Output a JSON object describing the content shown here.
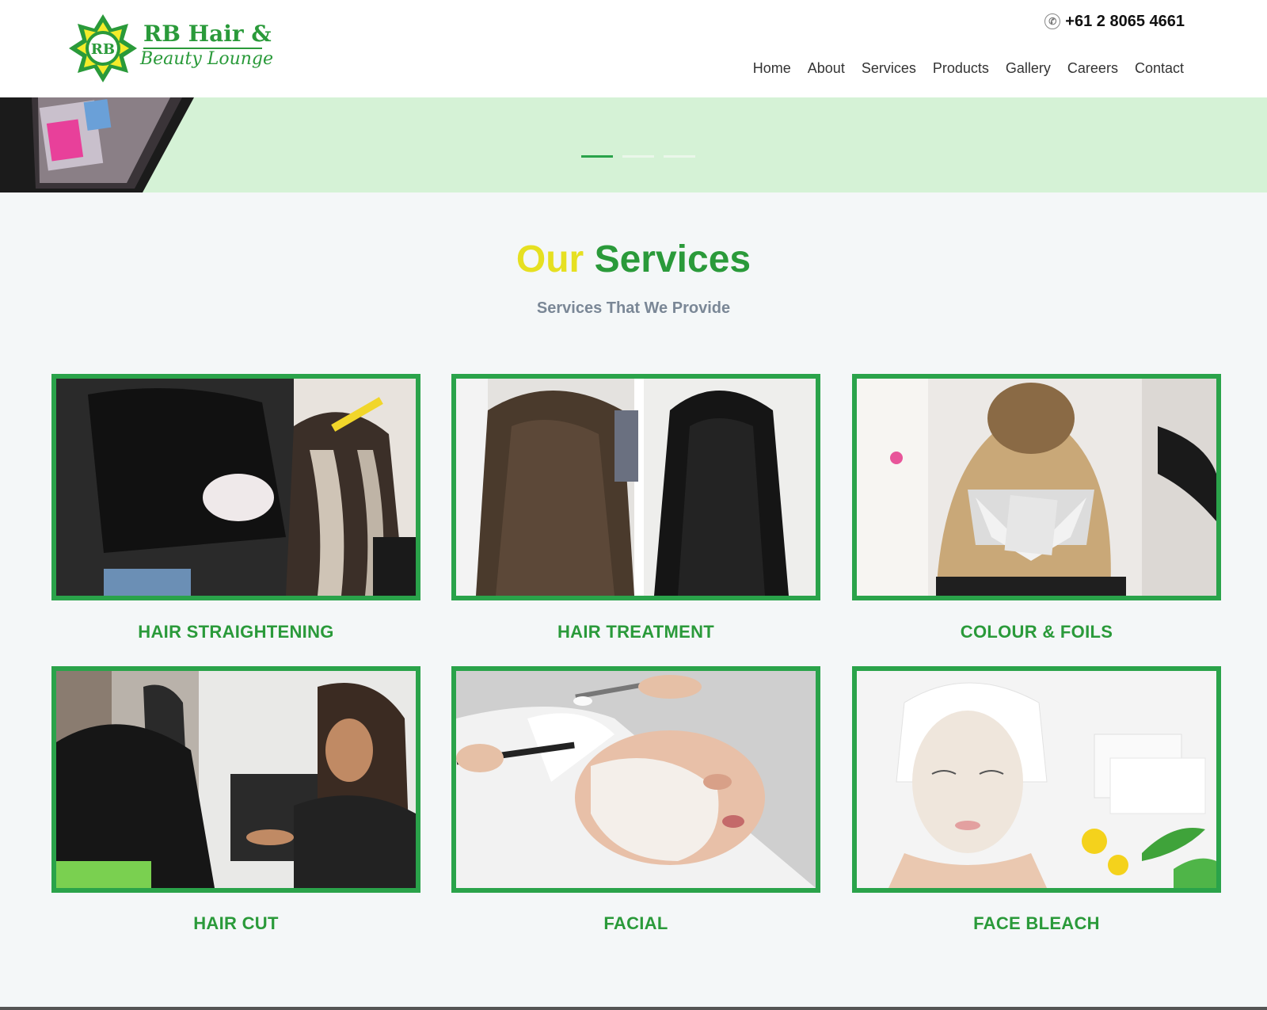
{
  "brand": {
    "line1": "RB Hair &",
    "line2": "Beauty Lounge",
    "logo_letters": "RB"
  },
  "header": {
    "phone": "+61 2 8065 4661",
    "nav": [
      "Home",
      "About",
      "Services",
      "Products",
      "Gallery",
      "Careers",
      "Contact"
    ]
  },
  "hero": {
    "slides": 3,
    "active_slide": 1
  },
  "section": {
    "title_part1": "Our",
    "title_part2": "Services",
    "subtitle": "Services That We Provide"
  },
  "services": [
    {
      "label": "HAIR STRAIGHTENING"
    },
    {
      "label": "HAIR TREATMENT"
    },
    {
      "label": "COLOUR & FOILS"
    },
    {
      "label": "HAIR CUT"
    },
    {
      "label": "FACIAL"
    },
    {
      "label": "FACE BLEACH"
    }
  ],
  "colors": {
    "green": "#2aa34a",
    "yellow": "#e6e021",
    "hero_bg": "#d5f2d6",
    "page_bg": "#f4f7f8"
  }
}
